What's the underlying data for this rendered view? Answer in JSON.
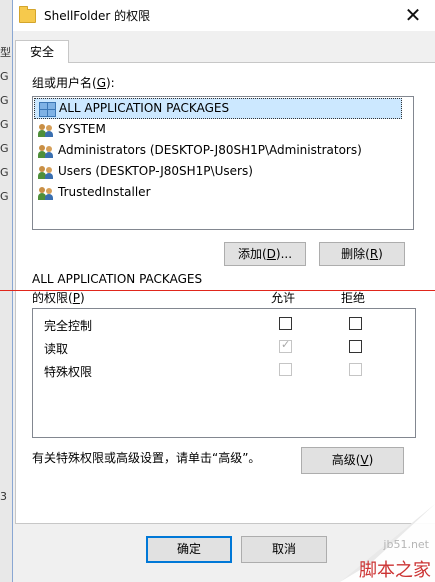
{
  "window": {
    "title": "ShellFolder 的权限"
  },
  "background_window": {
    "fragments": [
      "型",
      "G",
      "G",
      "G",
      "G",
      "G",
      "G",
      "3"
    ]
  },
  "tabs": [
    {
      "label": "安全"
    }
  ],
  "group": {
    "label_prefix": "组或用户名(",
    "label_key": "G",
    "label_suffix": "):"
  },
  "users": [
    {
      "name": "ALL APPLICATION PACKAGES",
      "icon": "app-packages-icon",
      "selected": true
    },
    {
      "name": "SYSTEM",
      "icon": "users-icon"
    },
    {
      "name": "Administrators (DESKTOP-J80SH1P\\Administrators)",
      "icon": "users-icon"
    },
    {
      "name": "Users (DESKTOP-J80SH1P\\Users)",
      "icon": "users-icon"
    },
    {
      "name": "TrustedInstaller",
      "icon": "users-icon"
    }
  ],
  "buttons": {
    "add": {
      "prefix": "添加(",
      "key": "D",
      "suffix": ")..."
    },
    "remove": {
      "prefix": "删除(",
      "key": "R",
      "suffix": ")"
    },
    "advanced": {
      "prefix": "高级(",
      "key": "V",
      "suffix": ")"
    },
    "ok": "确定",
    "cancel": "取消"
  },
  "permissions": {
    "heading": "ALL APPLICATION PACKAGES",
    "label_prefix": "的权限(",
    "label_key": "P",
    "label_suffix": ")",
    "col_allow": "允许",
    "col_deny": "拒绝",
    "rows": [
      {
        "name": "完全控制",
        "allow": false,
        "allow_disabled": false,
        "deny": false,
        "deny_disabled": false
      },
      {
        "name": "读取",
        "allow": true,
        "allow_disabled": true,
        "deny": false,
        "deny_disabled": false
      },
      {
        "name": "特殊权限",
        "allow": false,
        "allow_disabled": true,
        "deny": false,
        "deny_disabled": true
      }
    ]
  },
  "advanced_hint": "有关特殊权限或高级设置，请单击“高级”。",
  "watermark": {
    "url": "jb51.net",
    "text": "脚本之家"
  },
  "colors": {
    "selection": "#cce8ff",
    "default_button_border": "#0078d7",
    "annotation_line": "#e0261b"
  }
}
